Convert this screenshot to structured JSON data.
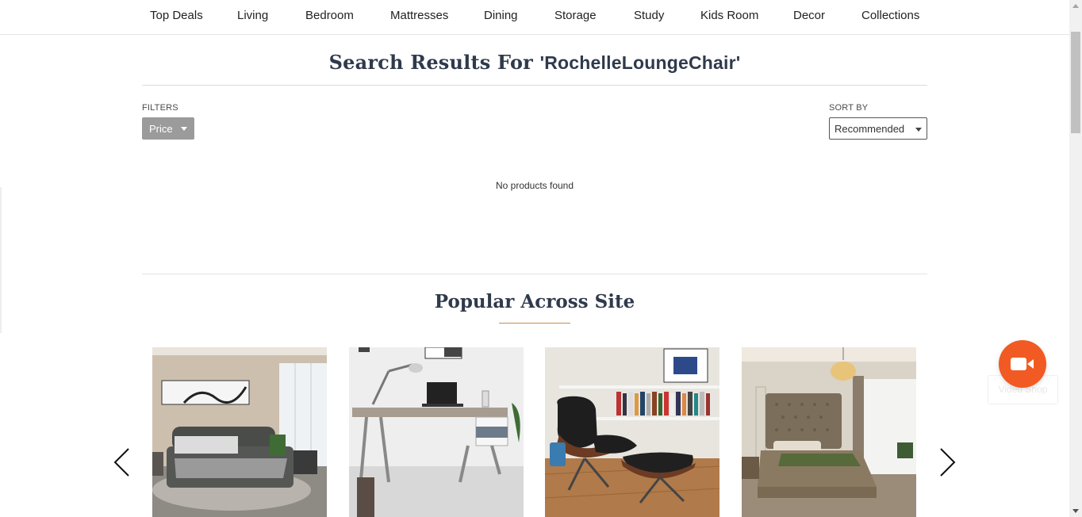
{
  "nav": {
    "items": [
      {
        "label": "Top Deals"
      },
      {
        "label": "Living"
      },
      {
        "label": "Bedroom"
      },
      {
        "label": "Mattresses"
      },
      {
        "label": "Dining"
      },
      {
        "label": "Storage"
      },
      {
        "label": "Study"
      },
      {
        "label": "Kids Room"
      },
      {
        "label": "Decor"
      },
      {
        "label": "Collections"
      }
    ]
  },
  "search": {
    "title_prefix": "Search Results For ",
    "query": "'RochelleLoungeChair'"
  },
  "filters": {
    "label": "FILTERS",
    "price_label": "Price"
  },
  "sort": {
    "label": "SORT BY",
    "selected": "Recommended"
  },
  "results": {
    "empty_message": "No products found"
  },
  "popular": {
    "title": "Popular Across Site",
    "cards": [
      {
        "image": "bed-dark-grey-image"
      },
      {
        "image": "study-desk-image"
      },
      {
        "image": "lounge-chair-ottoman-image"
      },
      {
        "image": "bed-tufted-headboard-image"
      }
    ]
  },
  "video_shop": {
    "label": "Video Shop",
    "color": "#f15a22",
    "icon": "video-camera-icon"
  },
  "colors": {
    "heading": "#2f3a4c",
    "accent": "#c98a4f",
    "filter_button": "#9b9b9b"
  }
}
